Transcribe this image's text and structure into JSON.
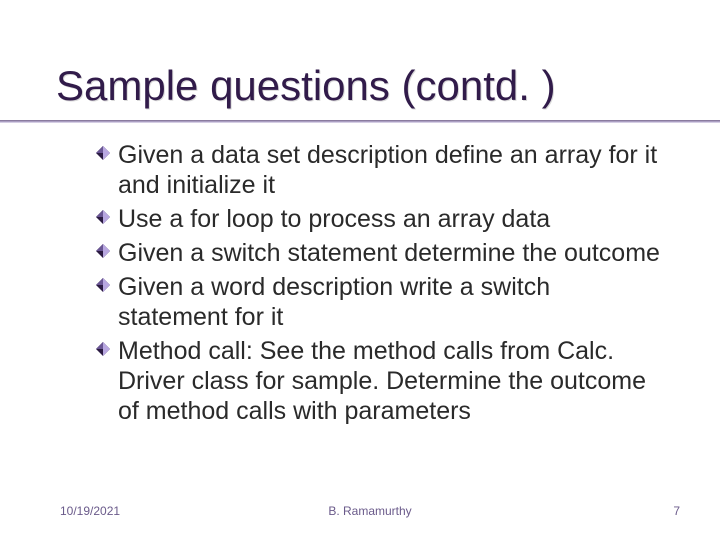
{
  "title": "Sample questions (contd. )",
  "bullets": [
    "Given a data set description define an array for it and initialize it",
    "Use a for loop to process an array data",
    "Given a switch statement determine the outcome",
    "Given a word description write a switch statement for it",
    "Method call: See the method calls from Calc. Driver class for sample. Determine the outcome of method calls with parameters"
  ],
  "footer": {
    "date": "10/19/2021",
    "author": "B. Ramamurthy",
    "page": "7"
  },
  "colors": {
    "title": "#311b4a",
    "accent": "#7a6a8e",
    "bullet_dark": "#2b1a42",
    "bullet_light": "#b8a7e0"
  }
}
